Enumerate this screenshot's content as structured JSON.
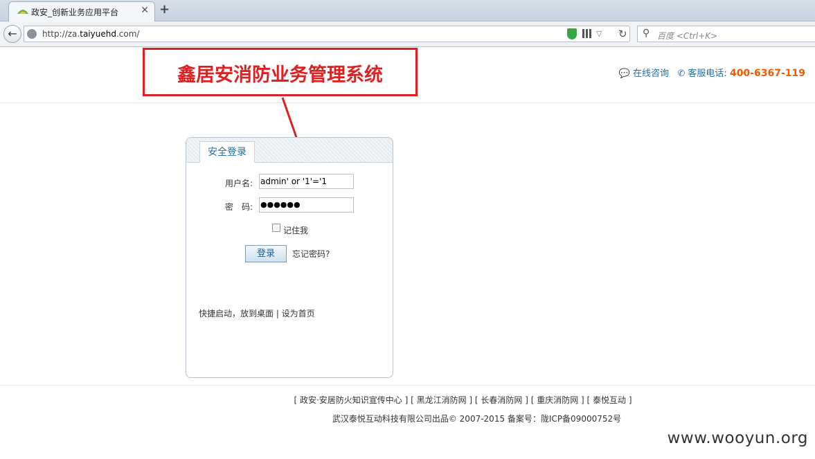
{
  "browser": {
    "tab_title": "政安_创新业务应用平台",
    "tab_close": "✕",
    "new_tab": "+",
    "url_prefix": "http://za.",
    "url_domain": "taiyuehd",
    "url_suffix": ".com/",
    "search_placeholder": "百度 <Ctrl+K>"
  },
  "header": {
    "system_title": "鑫居安消防业务管理系统",
    "online_consult": "在线咨询",
    "hotline_label": "客服电话:",
    "hotline_number": "400-6367-119"
  },
  "login": {
    "tab_label": "安全登录",
    "username_label": "用户名:",
    "username_value": "admin' or '1'='1",
    "password_label": "密　码:",
    "password_value": "●●●●●●",
    "remember_label": "记住我",
    "remember_checked": false,
    "submit_label": "登录",
    "forgot_label": "忘记密码?",
    "quick_links": "快捷启动，放到桌面 | 设为首页"
  },
  "footer": {
    "links": "[ 政安·安居防火知识宣传中心 ]   [ 黑龙江消防网 ]   [ 长春消防网 ]   [ 重庆消防网 ]   [ 泰悦互动 ]",
    "copyright": "武汉泰悦互动科技有限公司出品© 2007-2015 备案号：陇ICP备09000752号"
  },
  "watermark": "www.wooyun.org",
  "colors": {
    "annotation_red": "#e02020",
    "link_blue": "#1f6fa5",
    "hotline_orange": "#f05a00"
  }
}
